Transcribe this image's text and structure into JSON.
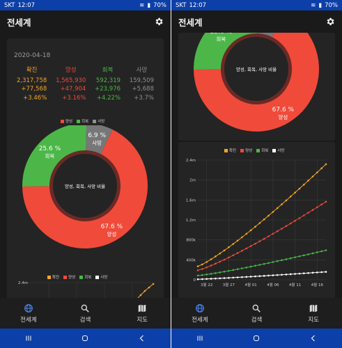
{
  "status_bar": {
    "carrier": "SKT",
    "time": "12:07",
    "battery": "70%"
  },
  "app": {
    "title": "전세계",
    "settings_icon": "gear-icon"
  },
  "summary": {
    "date": "2020-04-18",
    "columns": [
      {
        "label": "확진",
        "total": "2,317,758",
        "delta": "+77,568",
        "pct": "+3.46%",
        "color": "#f5a623"
      },
      {
        "label": "양성",
        "total": "1,565,930",
        "delta": "+47,904",
        "pct": "+3.16%",
        "color": "#f04a3a"
      },
      {
        "label": "회복",
        "total": "592,319",
        "delta": "+23,976",
        "pct": "+4.22%",
        "color": "#4cb748"
      },
      {
        "label": "사망",
        "total": "159,509",
        "delta": "+5,688",
        "pct": "+3.7%",
        "color": "#8f8f8f"
      }
    ]
  },
  "pie_legend": [
    {
      "label": "양성",
      "color": "#f04a3a"
    },
    {
      "label": "회복",
      "color": "#4cb748"
    },
    {
      "label": "사망",
      "color": "#8f8f8f"
    }
  ],
  "line_legend": [
    {
      "label": "확진",
      "color": "#f5a623"
    },
    {
      "label": "양성",
      "color": "#f04a3a"
    },
    {
      "label": "회복",
      "color": "#4cb748"
    },
    {
      "label": "사망",
      "color": "#ffffff"
    }
  ],
  "chart_data": [
    {
      "type": "pie",
      "center_label": "양성, 회복, 사망 비율",
      "slices": [
        {
          "name": "양성",
          "value": 67.6,
          "label": "67.6 %",
          "color": "#f04a3a"
        },
        {
          "name": "회복",
          "value": 25.6,
          "label": "25.6 %",
          "color": "#4cb748"
        },
        {
          "name": "사망",
          "value": 6.9,
          "label": "6.9 %",
          "color": "#777777"
        }
      ]
    },
    {
      "type": "line",
      "x_ticks": [
        "3월 22",
        "3월 27",
        "4월 01",
        "4월 06",
        "4월 11",
        "4월 16"
      ],
      "y_ticks": [
        "0",
        "400k",
        "800k",
        "1.2m",
        "1.6m",
        "2m",
        "2.4m"
      ],
      "ylim": [
        0,
        2400000
      ],
      "x_start": "3월 20",
      "x_end": "4월 18",
      "series": [
        {
          "name": "확진",
          "color": "#f5a623",
          "start": 270000,
          "end": 2317758
        },
        {
          "name": "양성",
          "color": "#f04a3a",
          "start": 190000,
          "end": 1565930
        },
        {
          "name": "회복",
          "color": "#4cb748",
          "start": 85000,
          "end": 592319
        },
        {
          "name": "사망",
          "color": "#ffffff",
          "start": 11000,
          "end": 159509
        }
      ]
    }
  ],
  "bottom_nav": [
    {
      "label": "전세계",
      "icon": "globe-icon"
    },
    {
      "label": "검색",
      "icon": "search-icon"
    },
    {
      "label": "지도",
      "icon": "map-icon"
    }
  ]
}
